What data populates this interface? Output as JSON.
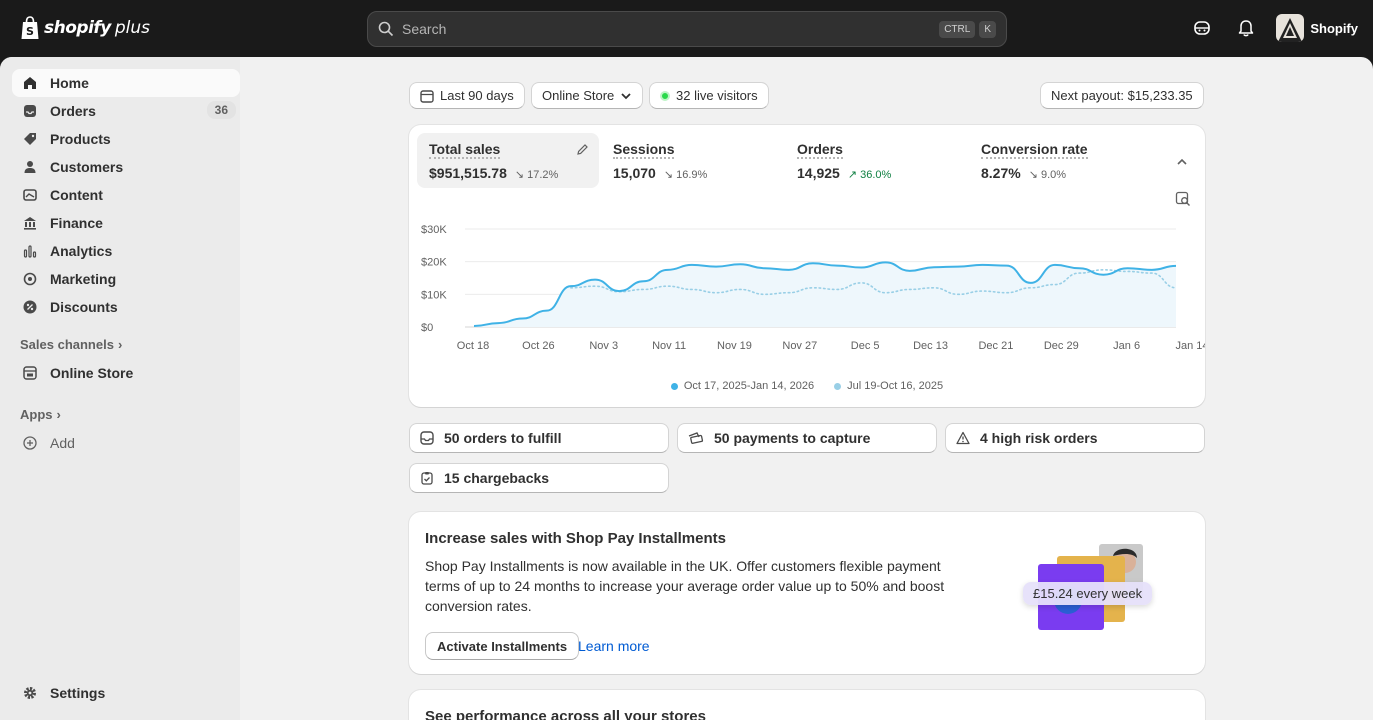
{
  "brand": {
    "name": "shopify",
    "suffix": "plus"
  },
  "search": {
    "placeholder": "Search",
    "shortcut_1": "CTRL",
    "shortcut_2": "K"
  },
  "header": {
    "store_name": "Shopify"
  },
  "sidebar": {
    "items": [
      {
        "label": "Home",
        "icon": "home-icon"
      },
      {
        "label": "Orders",
        "icon": "inbox-icon",
        "badge": "36"
      },
      {
        "label": "Products",
        "icon": "tag-icon"
      },
      {
        "label": "Customers",
        "icon": "person-icon"
      },
      {
        "label": "Content",
        "icon": "image-icon"
      },
      {
        "label": "Finance",
        "icon": "bank-icon"
      },
      {
        "label": "Analytics",
        "icon": "bar-chart-icon"
      },
      {
        "label": "Marketing",
        "icon": "target-icon"
      },
      {
        "label": "Discounts",
        "icon": "discount-icon"
      }
    ],
    "sales_channels_label": "Sales channels",
    "online_store_label": "Online Store",
    "apps_label": "Apps",
    "add_label": "Add",
    "settings_label": "Settings"
  },
  "filters": {
    "date_range": "Last 90 days",
    "channel": "Online Store",
    "live_visitors": "32 live visitors",
    "next_payout": "Next payout: $15,233.35"
  },
  "metrics": [
    {
      "label": "Total sales",
      "value": "$951,515.78",
      "delta": "17.2%",
      "direction": "down"
    },
    {
      "label": "Sessions",
      "value": "15,070",
      "delta": "16.9%",
      "direction": "down"
    },
    {
      "label": "Orders",
      "value": "14,925",
      "delta": "36.0%",
      "direction": "up"
    },
    {
      "label": "Conversion rate",
      "value": "8.27%",
      "delta": "9.0%",
      "direction": "down"
    }
  ],
  "chart_data": {
    "type": "line",
    "ylabels": [
      "$30K",
      "$20K",
      "$10K",
      "$0"
    ],
    "ylim": [
      0,
      30000
    ],
    "categories": [
      "Oct 18",
      "Oct 26",
      "Nov 3",
      "Nov 11",
      "Nov 19",
      "Nov 27",
      "Dec 5",
      "Dec 13",
      "Dec 21",
      "Dec 29",
      "Jan 6",
      "Jan 14"
    ],
    "grid": true,
    "series": [
      {
        "name": "Oct 17, 2025-Jan 14, 2026",
        "color": "#3fb2e6",
        "style": "solid",
        "values": [
          300,
          1200,
          2600,
          5000,
          12500,
          14500,
          11000,
          14000,
          17500,
          19000,
          18500,
          19200,
          18000,
          17500,
          19500,
          18800,
          18200,
          19800,
          17200,
          18300,
          18500,
          19000,
          18800,
          13500,
          19000,
          18000,
          16000,
          18000,
          17500,
          18700
        ]
      },
      {
        "name": "Jul 19-Oct 16, 2025",
        "color": "#99cfe6",
        "style": "dotted",
        "values": [
          null,
          null,
          null,
          null,
          12000,
          12500,
          10800,
          11500,
          12500,
          11500,
          10500,
          11500,
          10000,
          10500,
          12000,
          11500,
          13500,
          10500,
          11500,
          12000,
          10000,
          11000,
          10500,
          12000,
          13000,
          16500,
          17500,
          17000,
          16500,
          12000
        ]
      }
    ]
  },
  "tasks": [
    {
      "label": "50 orders to fulfill",
      "icon": "inbox-icon"
    },
    {
      "label": "50 payments to capture",
      "icon": "cash-icon"
    },
    {
      "label": "4 high risk orders",
      "icon": "alert-icon"
    },
    {
      "label": "15 chargebacks",
      "icon": "clipboard-icon"
    }
  ],
  "promo": {
    "title": "Increase sales with Shop Pay Installments",
    "body": "Shop Pay Installments is now available in the UK. Offer customers flexible payment terms of up to 24 months to increase your average order value up to 50% and boost conversion rates.",
    "primary_action": "Activate Installments",
    "secondary_action": "Learn more",
    "pill": "£15.24 every week"
  },
  "next_card": {
    "title": "See performance across all your stores"
  },
  "colors": {
    "accent": "#005bd3",
    "chart_primary": "#3fb2e6",
    "chart_secondary": "#99cfe6",
    "positive": "#108043"
  }
}
